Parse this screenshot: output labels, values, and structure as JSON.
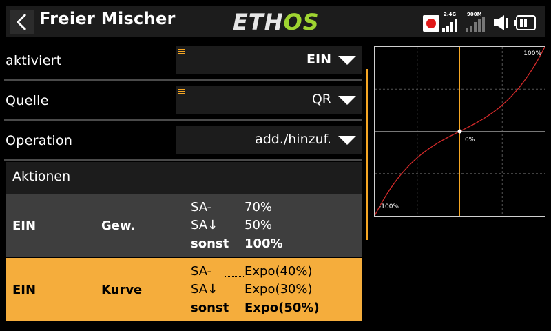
{
  "header": {
    "title": "Freier Mischer",
    "logo_main": "ETH",
    "logo_accent": "OS",
    "signal1_label": "2.4G",
    "signal2_label": "900M"
  },
  "fields": [
    {
      "label": "aktiviert",
      "value": "EIN"
    },
    {
      "label": "Quelle",
      "value": "QR"
    },
    {
      "label": "Operation",
      "value": "add./hinzuf."
    }
  ],
  "actions": {
    "header": "Aktionen",
    "rows": [
      {
        "state": "EIN",
        "type": "Gew.",
        "conditions": [
          {
            "switch": "SA-",
            "value": "70%"
          },
          {
            "switch": "SA↓",
            "value": "50%"
          },
          {
            "switch": "sonst",
            "value": "100%"
          }
        ]
      },
      {
        "state": "EIN",
        "type": "Kurve",
        "conditions": [
          {
            "switch": "SA-",
            "value": "Expo(40%)"
          },
          {
            "switch": "SA↓",
            "value": "Expo(30%)"
          },
          {
            "switch": "sonst",
            "value": "Expo(50%)"
          }
        ]
      }
    ]
  },
  "chart_data": {
    "type": "line",
    "label_max": "100%",
    "label_min": "-100%",
    "label_center": "0%",
    "x_range": [
      -100,
      100
    ],
    "y_range": [
      -100,
      100
    ],
    "curve": "expo",
    "expo_percent": 50,
    "series_color": "#d42a2a",
    "cursor_color": "#f5a623",
    "cursor_x": 0,
    "grid": true
  },
  "colors": {
    "accent": "#f5a623",
    "selected_row": "#f5ad3c",
    "logo_green": "#9fd431",
    "record": "#e01818"
  }
}
